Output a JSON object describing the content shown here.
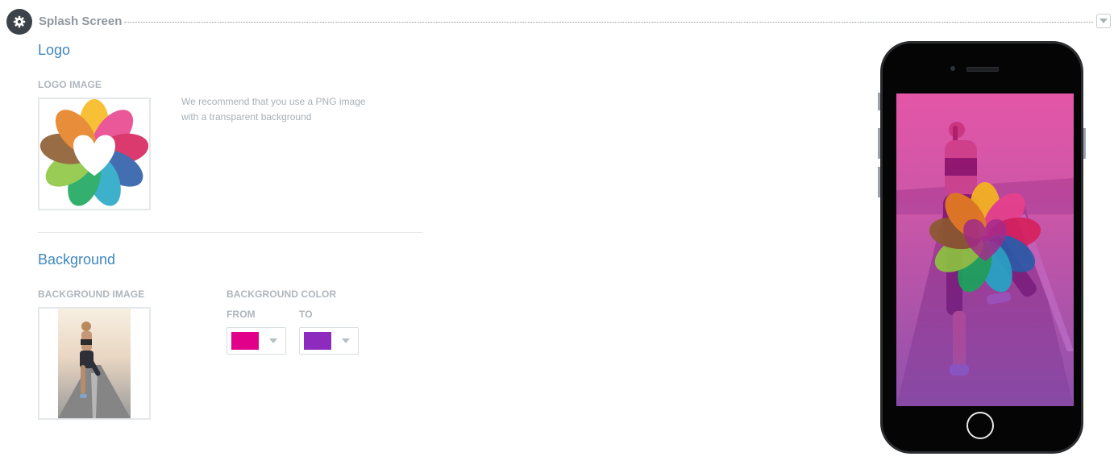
{
  "header": {
    "title": "Splash Screen",
    "icon": "gear-icon",
    "collapse_icon": "chevron-down-icon"
  },
  "logo_section": {
    "heading": "Logo",
    "logo_image_label": "LOGO IMAGE",
    "hint_line1": "We recommend that you use a PNG image",
    "hint_line2": "with a transparent background"
  },
  "background_section": {
    "heading": "Background",
    "background_image_label": "BACKGROUND IMAGE",
    "background_color_label": "BACKGROUND COLOR",
    "from_label": "FROM",
    "to_label": "TO",
    "from_color": "#e1008a",
    "to_color": "#8e2bbf"
  },
  "preview": {
    "device": "smartphone",
    "overlay_from": "#e1008a",
    "overlay_to": "#8e2bbf"
  }
}
